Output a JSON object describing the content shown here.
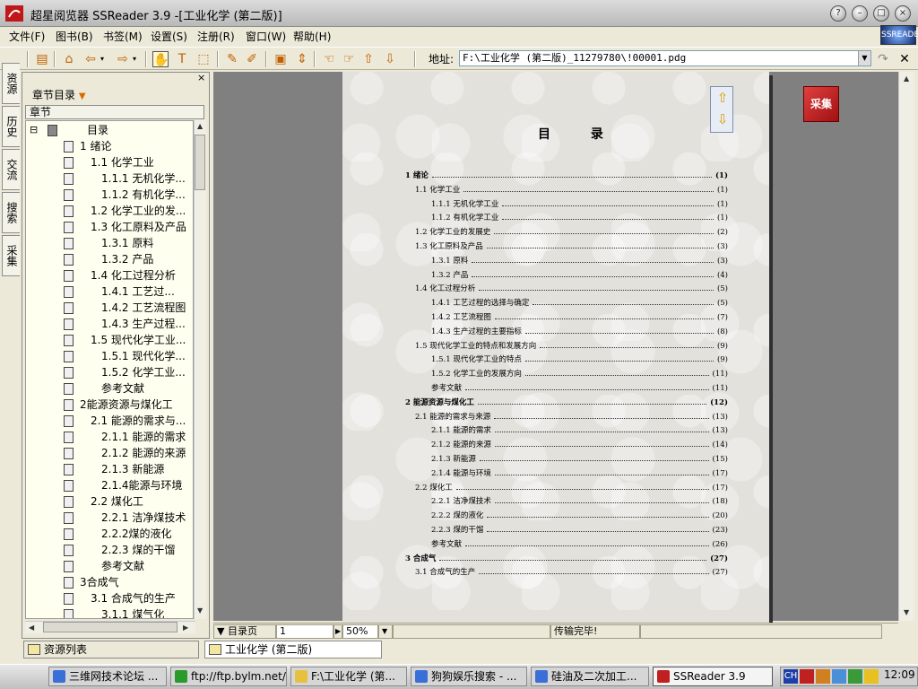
{
  "window": {
    "title": "超星阅览器 SSReader 3.9 -[工业化学  (第二版)]",
    "btn_help": "?",
    "btn_minimize": "–",
    "btn_maximize": "□",
    "btn_close": "×"
  },
  "menu": {
    "items": [
      "文件(F)",
      "图书(B)",
      "书签(M)",
      "设置(S)",
      "注册(R)",
      "窗口(W)",
      "帮助(H)"
    ]
  },
  "logo_text": "SSREADER",
  "toolbar": {
    "address_label": "地址:",
    "address_value": "F:\\工业化学  (第二版)_11279780\\!00001.pdg",
    "icons": [
      "page-icon",
      "home-icon",
      "back-icon",
      "forward-icon",
      "hand-tool-icon",
      "text-tool-icon",
      "select-tool-icon",
      "annotate-icon",
      "highlight-icon",
      "fit-page-icon",
      "fit-width-icon",
      "first-page-icon",
      "last-page-icon",
      "up-icon",
      "down-icon",
      "go-icon",
      "close-icon"
    ]
  },
  "vtabs": [
    "资源",
    "历史",
    "交流",
    "搜索",
    "采集"
  ],
  "panel": {
    "title": "章节目录",
    "close": "×",
    "column_header": "章节"
  },
  "tree": [
    {
      "label": "目录",
      "level": 0,
      "root": true
    },
    {
      "label": "1  绪论",
      "level": 1
    },
    {
      "label": "1.1  化学工业",
      "level": 2
    },
    {
      "label": "1.1.1  无机化学...",
      "level": 3
    },
    {
      "label": "1.1.2  有机化学...",
      "level": 3
    },
    {
      "label": "1.2  化学工业的发...",
      "level": 2
    },
    {
      "label": "1.3  化工原料及产品",
      "level": 2
    },
    {
      "label": "1.3.1  原料",
      "level": 3
    },
    {
      "label": "1.3.2  产品",
      "level": 3
    },
    {
      "label": "1.4  化工过程分析",
      "level": 2
    },
    {
      "label": "1.4.1  工艺过...",
      "level": 3
    },
    {
      "label": "1.4.2  工艺流程图",
      "level": 3
    },
    {
      "label": "1.4.3  生产过程...",
      "level": 3
    },
    {
      "label": "1.5  现代化学工业...",
      "level": 2
    },
    {
      "label": "1.5.1  现代化学...",
      "level": 3
    },
    {
      "label": "1.5.2  化学工业...",
      "level": 3
    },
    {
      "label": "参考文献",
      "level": 3
    },
    {
      "label": "2能源资源与煤化工",
      "level": 1
    },
    {
      "label": "2.1  能源的需求与...",
      "level": 2
    },
    {
      "label": "2.1.1  能源的需求",
      "level": 3
    },
    {
      "label": "2.1.2  能源的来源",
      "level": 3
    },
    {
      "label": "2.1.3  新能源",
      "level": 3
    },
    {
      "label": "2.1.4能源与环境",
      "level": 3
    },
    {
      "label": "2.2  煤化工",
      "level": 2
    },
    {
      "label": "2.2.1  洁净煤技术",
      "level": 3
    },
    {
      "label": "2.2.2煤的液化",
      "level": 3
    },
    {
      "label": "2.2.3  煤的干馏",
      "level": 3
    },
    {
      "label": "参考文献",
      "level": 3
    },
    {
      "label": "3合成气",
      "level": 1
    },
    {
      "label": "3.1  合成气的生产",
      "level": 2
    },
    {
      "label": "3.1.1  煤气化",
      "level": 3
    }
  ],
  "page": {
    "title": "目  录",
    "toc": [
      {
        "t": "1  绪论",
        "p": "(1)",
        "lvl": 0,
        "bold": true
      },
      {
        "t": "1.1  化学工业",
        "p": "(1)",
        "lvl": 1
      },
      {
        "t": "1.1.1  无机化学工业",
        "p": "(1)",
        "lvl": 2
      },
      {
        "t": "1.1.2  有机化学工业",
        "p": "(1)",
        "lvl": 2
      },
      {
        "t": "1.2  化学工业的发展史",
        "p": "(2)",
        "lvl": 1
      },
      {
        "t": "1.3  化工原料及产品",
        "p": "(3)",
        "lvl": 1
      },
      {
        "t": "1.3.1  原料",
        "p": "(3)",
        "lvl": 2
      },
      {
        "t": "1.3.2  产品",
        "p": "(4)",
        "lvl": 2
      },
      {
        "t": "1.4  化工过程分析",
        "p": "(5)",
        "lvl": 1
      },
      {
        "t": "1.4.1  工艺过程的选择与确定",
        "p": "(5)",
        "lvl": 2
      },
      {
        "t": "1.4.2  工艺流程图",
        "p": "(7)",
        "lvl": 2
      },
      {
        "t": "1.4.3  生产过程的主要指标",
        "p": "(8)",
        "lvl": 2
      },
      {
        "t": "1.5  现代化学工业的特点和发展方向",
        "p": "(9)",
        "lvl": 1
      },
      {
        "t": "1.5.1  现代化学工业的特点",
        "p": "(9)",
        "lvl": 2
      },
      {
        "t": "1.5.2  化学工业的发展方向",
        "p": "(11)",
        "lvl": 2
      },
      {
        "t": "参考文献",
        "p": "(11)",
        "lvl": 2
      },
      {
        "t": "2  能源资源与煤化工",
        "p": "(12)",
        "lvl": 0,
        "bold": true
      },
      {
        "t": "2.1  能源的需求与来源",
        "p": "(13)",
        "lvl": 1
      },
      {
        "t": "2.1.1  能源的需求",
        "p": "(13)",
        "lvl": 2
      },
      {
        "t": "2.1.2  能源的来源",
        "p": "(14)",
        "lvl": 2
      },
      {
        "t": "2.1.3  新能源",
        "p": "(15)",
        "lvl": 2
      },
      {
        "t": "2.1.4  能源与环境",
        "p": "(17)",
        "lvl": 2
      },
      {
        "t": "2.2  煤化工",
        "p": "(17)",
        "lvl": 1
      },
      {
        "t": "2.2.1  洁净煤技术",
        "p": "(18)",
        "lvl": 2
      },
      {
        "t": "2.2.2  煤的液化",
        "p": "(20)",
        "lvl": 2
      },
      {
        "t": "2.2.3  煤的干馏",
        "p": "(23)",
        "lvl": 2
      },
      {
        "t": "参考文献",
        "p": "(26)",
        "lvl": 2
      },
      {
        "t": "3  合成气",
        "p": "(27)",
        "lvl": 0,
        "bold": true
      },
      {
        "t": "3.1  合成气的生产",
        "p": "(27)",
        "lvl": 1
      }
    ]
  },
  "collect_label": "采集",
  "status": {
    "page_type": "目录页",
    "page_number": "1",
    "zoom": "50%",
    "message": "传输完毕!"
  },
  "bottom_tabs": [
    {
      "label": "资源列表"
    },
    {
      "label": "工业化学  (第二版)"
    }
  ],
  "taskbar": {
    "tasks": [
      {
        "label": "三维网技术论坛 ...",
        "color": "#3a6fd8"
      },
      {
        "label": "ftp://ftp.bylm.net/...",
        "color": "#2a9a2a"
      },
      {
        "label": "F:\\工业化学  (第...",
        "color": "#e8c040"
      },
      {
        "label": "狗狗娱乐搜索 - ...",
        "color": "#3a6fd8"
      },
      {
        "label": "硅油及二次加工...",
        "color": "#3a6fd8"
      },
      {
        "label": "SSReader 3.9",
        "color": "#c02020",
        "active": true
      }
    ],
    "tray_label": "CH",
    "clock": "12:09"
  }
}
